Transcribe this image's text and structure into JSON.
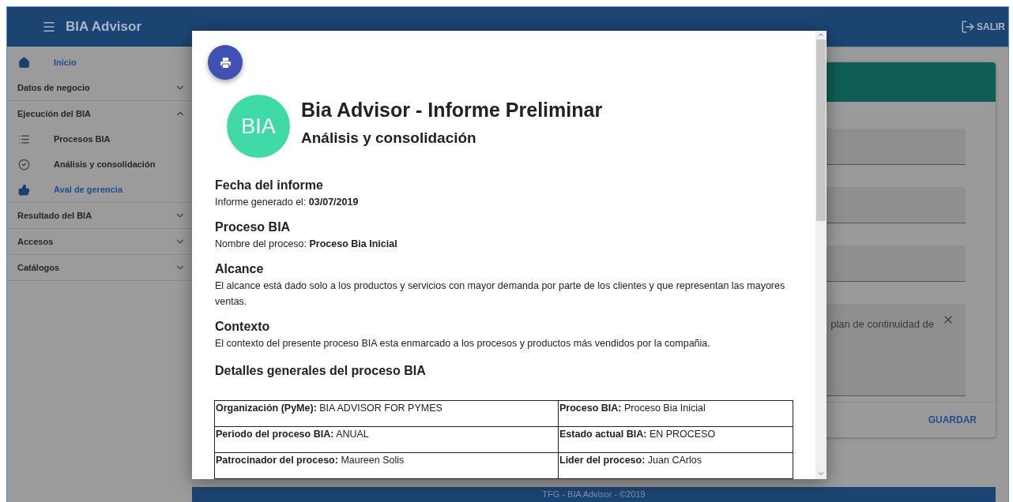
{
  "header": {
    "title": "BIA Advisor",
    "logout": "SALIR"
  },
  "sidebar": {
    "items": [
      {
        "kind": "link",
        "label": "Inicio",
        "selected": true
      },
      {
        "kind": "group",
        "label": "Datos de negocio",
        "expanded": false
      },
      {
        "kind": "group",
        "label": "Ejecución del BIA",
        "expanded": true,
        "children": [
          {
            "kind": "link",
            "label": "Procesos BIA",
            "selected": false
          },
          {
            "kind": "link",
            "label": "Análisis y consolidación",
            "selected": false
          },
          {
            "kind": "link",
            "label": "Aval de gerencia",
            "selected": true
          }
        ]
      },
      {
        "kind": "group",
        "label": "Resultado del BIA",
        "expanded": false
      },
      {
        "kind": "group",
        "label": "Accesos",
        "expanded": false
      },
      {
        "kind": "group",
        "label": "Catálogos",
        "expanded": false
      }
    ]
  },
  "form_card": {
    "textarea_value": "plan de continuidad de",
    "save_button": "GUARDAR"
  },
  "footer": "TFG - BIA Advisor - ©2019",
  "report": {
    "logo": "BIA",
    "title": "Bia Advisor - Informe Preliminar",
    "subtitle": "Análisis y consolidación",
    "sections": [
      {
        "heading": "Fecha del informe",
        "text": "Informe generado el: **03/07/2019**"
      },
      {
        "heading": "Proceso BIA",
        "text": "Nombre del proceso: **Proceso Bia Inicial**"
      },
      {
        "heading": "Alcance",
        "text": "El alcance está dado solo a los productos y servicios con mayor demanda por parte de los clientes y que representan las mayores ventas."
      },
      {
        "heading": "Contexto",
        "text": "El contexto del presente proceso BIA esta enmarcado a los procesos y productos más vendidos por la compañia."
      }
    ],
    "details_heading": "Detalles generales del proceso BIA",
    "details_rows": [
      [
        {
          "label": "Organización (PyMe):",
          "value": "BIA ADVISOR FOR PYMES"
        },
        {
          "label": "Proceso BIA:",
          "value": "Proceso Bia Inicial"
        }
      ],
      [
        {
          "label": "Periodo del proceso BIA:",
          "value": "ANUAL"
        },
        {
          "label": "Estado actual BIA:",
          "value": "EN PROCESO"
        }
      ],
      [
        {
          "label": "Patrocinador del proceso:",
          "value": "Maureen Solis"
        },
        {
          "label": "Lider del proceso:",
          "value": "Juan CArlos"
        }
      ]
    ]
  }
}
